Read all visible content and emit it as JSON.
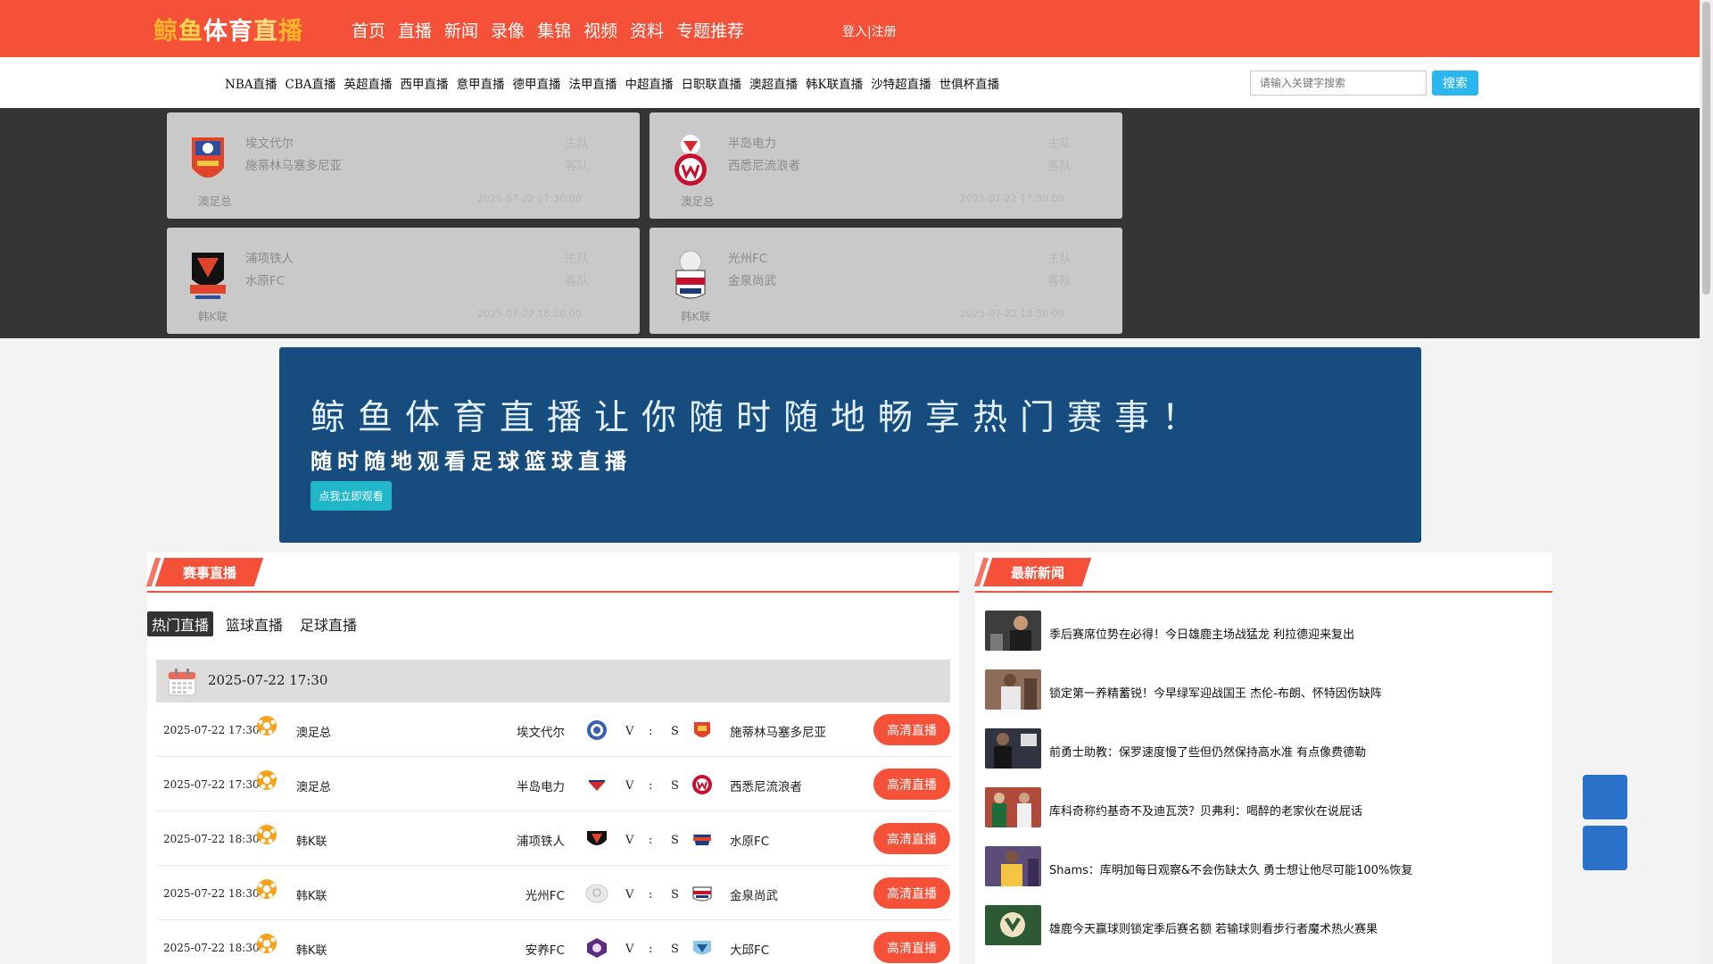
{
  "header": {
    "logo_chars": [
      "鲸",
      "鱼",
      "体",
      "育",
      "直",
      "播"
    ],
    "nav": [
      "首页",
      "直播",
      "新闻",
      "录像",
      "集锦",
      "视频",
      "资料",
      "专题推荐"
    ],
    "login": "登入|注册",
    "accent": "#f55138"
  },
  "subnav": {
    "items": [
      "NBA直播",
      "CBA直播",
      "英超直播",
      "西甲直播",
      "意甲直播",
      "德甲直播",
      "法甲直播",
      "中超直播",
      "日职联直播",
      "澳超直播",
      "韩K联直播",
      "沙特超直播",
      "世俱杯直播"
    ],
    "search_placeholder": "请输入关键字搜索",
    "search_button": "搜索"
  },
  "hero_cards": [
    {
      "home": "埃文代尔",
      "away": "施蒂林马塞多尼亚",
      "home_label": "主队",
      "away_label": "客队",
      "league": "澳足总",
      "time": "2025-07-22 17:30:00",
      "logo": "avondale-logo"
    },
    {
      "home": "半岛电力",
      "away": "西悉尼流浪者",
      "home_label": "主队",
      "away_label": "客队",
      "league": "澳足总",
      "time": "2025-07-22 17:30:00",
      "logo": "wanderers-logo"
    },
    {
      "home": "浦项铁人",
      "away": "水原FC",
      "home_label": "主队",
      "away_label": "客队",
      "league": "韩K联",
      "time": "2025-07-22 18:30:00",
      "logo": "pohang-logo"
    },
    {
      "home": "光州FC",
      "away": "金泉尚武",
      "home_label": "主队",
      "away_label": "客队",
      "league": "韩K联",
      "time": "2025-07-22 18:30:00",
      "logo": "gimcheon-logo"
    }
  ],
  "banner": {
    "headline": "鲸鱼体育直播让你随时随地畅享热门赛事！",
    "subline": "随时随地观看足球篮球直播",
    "cta": "点我立即观看"
  },
  "live": {
    "section_title": "赛事直播",
    "tabs": [
      "热门直播",
      "篮球直播",
      "足球直播"
    ],
    "date_header": "2025-07-22 17:30",
    "matches": [
      {
        "time": "2025-07-22 17:30",
        "league": "澳足总",
        "home": "埃文代尔",
        "v": "V",
        "colon": ":",
        "s": "S",
        "away": "施蒂林马塞多尼亚",
        "button": "高清直播"
      },
      {
        "time": "2025-07-22 17:30",
        "league": "澳足总",
        "home": "半岛电力",
        "v": "V",
        "colon": ":",
        "s": "S",
        "away": "西悉尼流浪者",
        "button": "高清直播"
      },
      {
        "time": "2025-07-22 18:30",
        "league": "韩K联",
        "home": "浦项铁人",
        "v": "V",
        "colon": ":",
        "s": "S",
        "away": "水原FC",
        "button": "高清直播"
      },
      {
        "time": "2025-07-22 18:30",
        "league": "韩K联",
        "home": "光州FC",
        "v": "V",
        "colon": ":",
        "s": "S",
        "away": "金泉尚武",
        "button": "高清直播"
      },
      {
        "time": "2025-07-22 18:30",
        "league": "韩K联",
        "home": "安养FC",
        "v": "V",
        "colon": ":",
        "s": "S",
        "away": "大邱FC",
        "button": "高清直播"
      }
    ]
  },
  "news": {
    "section_title": "最新新闻",
    "items": [
      "季后赛席位势在必得！今日雄鹿主场战猛龙 利拉德迎来复出",
      "锁定第一养精蓄锐！今早绿军迎战国王 杰伦-布朗、怀特因伤缺阵",
      "前勇士助教：保罗速度慢了些但仍然保持高水准 有点像费德勒",
      "库科奇称约基奇不及迪瓦茨？贝弗利：喝醉的老家伙在说屁话",
      "Shams：库明加每日观察&不会伤缺太久 勇士想让他尽可能100%恢复",
      "雄鹿今天赢球则锁定季后赛名额 若输球则看步行者魔术热火赛果"
    ]
  }
}
